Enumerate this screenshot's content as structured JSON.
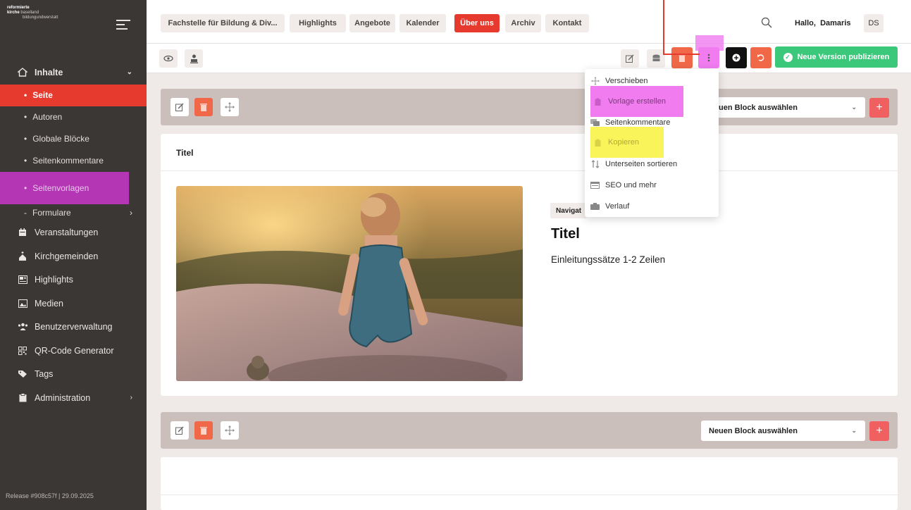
{
  "sidebar": {
    "logo_lines": [
      "reformierte",
      "kirche baselland",
      "bildungundwerstatt"
    ],
    "nav": [
      {
        "label": "Inhalte",
        "icon": "home-icon",
        "chevron": "⌄"
      },
      {
        "label": "Seite"
      },
      {
        "label": "Autoren"
      },
      {
        "label": "Globale Blöcke"
      },
      {
        "label": "Seitenkommentare"
      },
      {
        "label": "Seitenvorlagen"
      },
      {
        "label": "Formulare",
        "chevron": "›"
      },
      {
        "label": "Veranstaltungen",
        "icon": "calendar-icon"
      },
      {
        "label": "Kirchgemeinden",
        "icon": "church-icon"
      },
      {
        "label": "Highlights",
        "icon": "highlights-icon"
      },
      {
        "label": "Medien",
        "icon": "media-icon"
      },
      {
        "label": "Benutzerverwaltung",
        "icon": "users-icon"
      },
      {
        "label": "QR-Code Generator",
        "icon": "qr-icon"
      },
      {
        "label": "Tags",
        "icon": "tag-icon"
      },
      {
        "label": "Administration",
        "icon": "clipboard-icon",
        "chevron": "›"
      }
    ],
    "release": "Release #908c57f | 29.09.2025"
  },
  "topbar": {
    "tabs": [
      "Fachstelle für Bildung & Div...",
      "Highlights",
      "Angebote",
      "Kalender",
      "Über uns",
      "Archiv",
      "Kontakt"
    ],
    "greeting": "Hallo,",
    "user": "Damaris",
    "initials": "DS"
  },
  "toolbar": {
    "publish_label": "Neue Version publizieren"
  },
  "block_select": {
    "label": "Neuen Block auswählen",
    "caret": "⌄",
    "plus": "+"
  },
  "content": {
    "card_title": "Titel",
    "nav_badge": "Navigat",
    "big_title": "Titel",
    "intro": "Einleitungssätze 1-2 Zeilen"
  },
  "menu": {
    "items": [
      "Verschieben",
      "Vorlage erstellen",
      "Seitenkommentare",
      "Kopieren",
      "Unterseiten sortieren",
      "SEO und mehr",
      "Verlauf"
    ]
  },
  "colors": {
    "brand_red": "#e63a2e",
    "publish_green": "#3cc87a",
    "highlight_pink": "#f07cf0",
    "highlight_yellow": "#f8f45a",
    "sidebar_bg": "#3b3735"
  }
}
